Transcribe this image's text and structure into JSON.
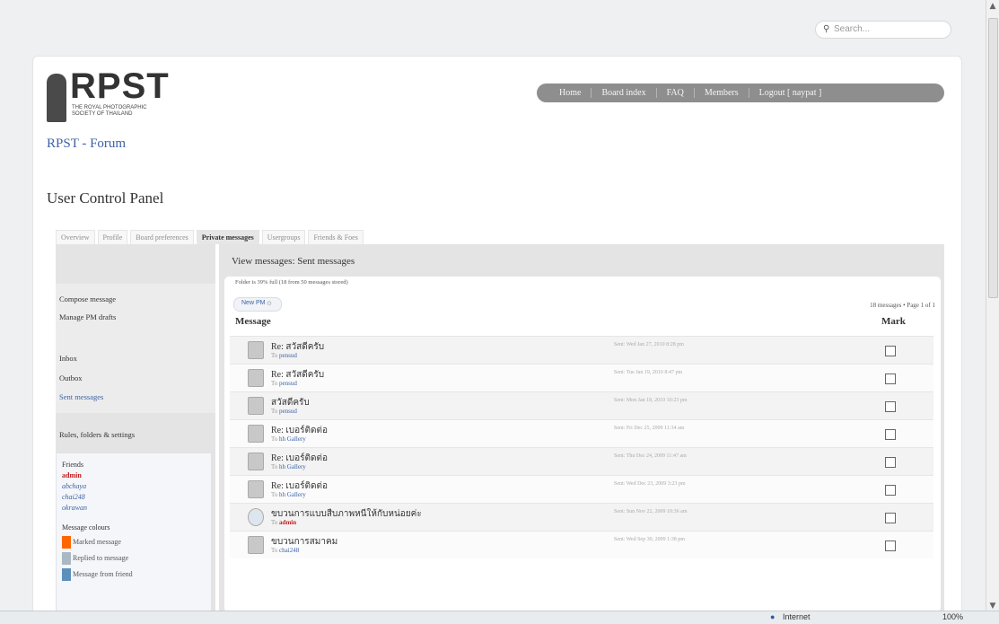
{
  "search": {
    "placeholder": "Search..."
  },
  "logo": {
    "big": "RPST",
    "line1": "THE ROYAL PHOTOGRAPHIC",
    "line2": "SOCIETY OF THAILAND"
  },
  "nav": [
    "Home",
    "Board index",
    "FAQ",
    "Members",
    "Logout [ naypat ]"
  ],
  "forum_title": "RPST - Forum",
  "page_title": "User Control Panel",
  "tabs": [
    "Overview",
    "Profile",
    "Board preferences",
    "Private messages",
    "Usergroups",
    "Friends & Foes"
  ],
  "sidebar": {
    "compose": "Compose message",
    "drafts": "Manage PM drafts",
    "inbox": "Inbox",
    "outbox": "Outbox",
    "sent": "Sent messages",
    "rules": "Rules, folders & settings",
    "friends_title": "Friends",
    "friends": [
      "admin",
      "abchaya",
      "chai248",
      "okrawan"
    ],
    "colours_title": "Message colours",
    "colours": [
      {
        "label": "Marked message",
        "color": "#ff6600"
      },
      {
        "label": "Replied to message",
        "color": "#a9b8c2"
      },
      {
        "label": "Message from friend",
        "color": "#5c8fbb"
      }
    ]
  },
  "main": {
    "heading": "View messages: Sent messages",
    "folder_info": "Folder is 39% full (18 from 50 messages stored)",
    "new_pm": "New PM",
    "pagination": "18 messages • Page 1 of 1",
    "col_message": "Message",
    "col_mark": "Mark",
    "rows": [
      {
        "title": "Re: สวัสดีครับ",
        "to_prefix": "To",
        "to": "pensud",
        "date": "Sent: Wed Jan 27, 2010 8:28 pm"
      },
      {
        "title": "Re: สวัสดีครับ",
        "to_prefix": "To",
        "to": "pensud",
        "date": "Sent: Tue Jan 19, 2010 8:47 pm"
      },
      {
        "title": "สวัสดีครับ",
        "to_prefix": "To",
        "to": "pensud",
        "date": "Sent: Mon Jan 18, 2010 10:23 pm"
      },
      {
        "title": "Re: เบอร์ติดต่อ",
        "to_prefix": "To",
        "to": "hh Gallery",
        "date": "Sent: Fri Dec 25, 2009 11:34 am"
      },
      {
        "title": "Re: เบอร์ติดต่อ",
        "to_prefix": "To",
        "to": "hh Gallery",
        "date": "Sent: Thu Dec 24, 2009 11:47 am"
      },
      {
        "title": "Re: เบอร์ติดต่อ",
        "to_prefix": "To",
        "to": "hh Gallery",
        "date": "Sent: Wed Dec 23, 2009 3:23 pm"
      },
      {
        "title": "ขบวนการแบบสืบภาพหนีให้กับหน่อยค่ะ",
        "to_prefix": "To",
        "to": "admin",
        "date": "Sent: Sun Nov 22, 2009 10:36 am"
      },
      {
        "title": "ขบวนการสมาคม",
        "to_prefix": "To",
        "to": "chai248",
        "date": "Sent: Wed Sep 30, 2009 1:38 pm"
      }
    ]
  },
  "statusbar": {
    "zone": "Internet",
    "zoom": "100%"
  }
}
